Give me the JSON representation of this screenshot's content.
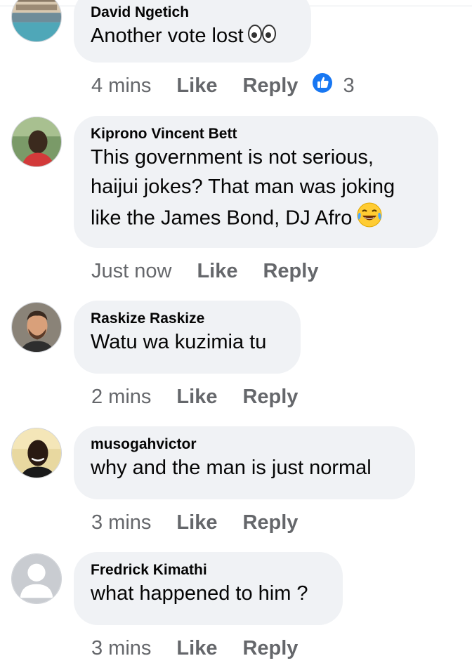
{
  "colors": {
    "bubble_bg": "#f0f2f5",
    "text": "#050505",
    "meta": "#65676b",
    "like_blue": "#1877f2"
  },
  "comments": [
    {
      "author": "David Ngetich",
      "lines": [
        "Another vote lost"
      ],
      "emoji": "eyes-emoji",
      "time": "4 mins",
      "like_label": "Like",
      "reply_label": "Reply",
      "reaction_icon": "thumbs-up-icon",
      "reaction_count": "3"
    },
    {
      "author": "Kiprono Vincent Bett",
      "lines": [
        "This government is not serious,",
        "haijui jokes? That man was joking",
        "like the James Bond, DJ Afro"
      ],
      "emoji": "laughing-tears-emoji",
      "time": "Just now",
      "like_label": "Like",
      "reply_label": "Reply"
    },
    {
      "author": "Raskize Raskize",
      "lines": [
        "Watu wa kuzimia tu"
      ],
      "time": "2 mins",
      "like_label": "Like",
      "reply_label": "Reply"
    },
    {
      "author": "musogahvictor",
      "lines": [
        "why and the man is just normal"
      ],
      "time": "3 mins",
      "like_label": "Like",
      "reply_label": "Reply"
    },
    {
      "author": "Fredrick Kimathi",
      "lines": [
        "what happened to him ?"
      ],
      "time": "3 mins",
      "like_label": "Like",
      "reply_label": "Reply"
    }
  ]
}
